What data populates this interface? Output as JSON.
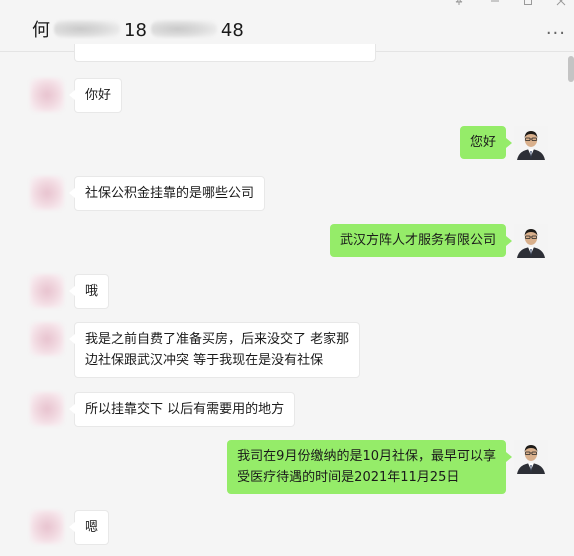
{
  "window": {
    "title_prefix": "何",
    "title_mid": "18",
    "title_suffix": "48",
    "title_redacted": true,
    "controls": [
      "pin-icon",
      "minimize-icon",
      "maximize-icon",
      "close-icon"
    ],
    "more_label": "..."
  },
  "colors": {
    "background": "#f5f5f5",
    "incoming_bubble": "#ffffff",
    "outgoing_bubble": "#95ec69",
    "text": "#1a1a1a"
  },
  "messages": [
    {
      "side": "in",
      "lines": [
        "你好"
      ]
    },
    {
      "side": "out",
      "lines": [
        "您好"
      ]
    },
    {
      "side": "in",
      "lines": [
        "社保公积金挂靠的是哪些公司"
      ]
    },
    {
      "side": "out",
      "lines": [
        "武汉方阵人才服务有限公司"
      ]
    },
    {
      "side": "in",
      "lines": [
        "哦"
      ]
    },
    {
      "side": "in",
      "lines": [
        "我是之前自费了准备买房，后来没交了 老家那",
        "边社保跟武汉冲突 等于我现在是没有社保"
      ]
    },
    {
      "side": "in",
      "lines": [
        "所以挂靠交下 以后有需要用的地方"
      ]
    },
    {
      "side": "out",
      "lines": [
        "我司在9月份缴纳的是10月社保，最早可以享",
        "受医疗待遇的时间是2021年11月25日"
      ]
    },
    {
      "side": "in",
      "lines": [
        "嗯"
      ]
    }
  ]
}
